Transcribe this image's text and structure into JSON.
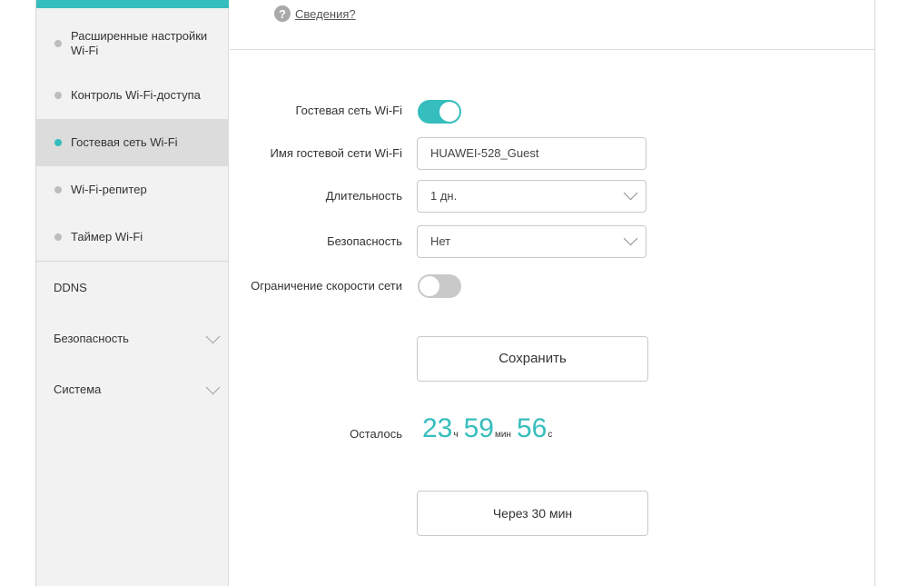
{
  "sidebar": {
    "sub_items": [
      {
        "label": "Расширенные настройки Wi-Fi",
        "active": false
      },
      {
        "label": "Контроль Wi-Fi-доступа",
        "active": false
      },
      {
        "label": "Гостевая сеть Wi-Fi",
        "active": true
      },
      {
        "label": "Wi-Fi-репитер",
        "active": false
      },
      {
        "label": "Таймер Wi-Fi",
        "active": false
      }
    ],
    "top_items": [
      {
        "label": "DDNS"
      },
      {
        "label": "Безопасность"
      },
      {
        "label": "Система"
      }
    ]
  },
  "hint": {
    "link": "Сведения?",
    "icon": "help-icon"
  },
  "form": {
    "guest_wifi_label": "Гостевая сеть Wi-Fi",
    "guest_wifi_enabled": true,
    "ssid_label": "Имя гостевой сети Wi-Fi",
    "ssid_value": "HUAWEI-528_Guest",
    "duration_label": "Длительность",
    "duration_value": "1 дн.",
    "security_label": "Безопасность",
    "security_value": "Нет",
    "speed_limit_label": "Ограничение скорости сети",
    "speed_limit_enabled": false,
    "save_button": "Сохранить"
  },
  "remaining": {
    "label": "Осталось",
    "hours": "23",
    "hours_unit": "ч",
    "minutes": "59",
    "minutes_unit": "мин",
    "seconds": "56",
    "seconds_unit": "с"
  },
  "extend_button": "Через 30 мин",
  "colors": {
    "accent": "#36bdbd",
    "sidebar_bg": "#f2f2f2",
    "active_bg": "#dcdcdc"
  }
}
